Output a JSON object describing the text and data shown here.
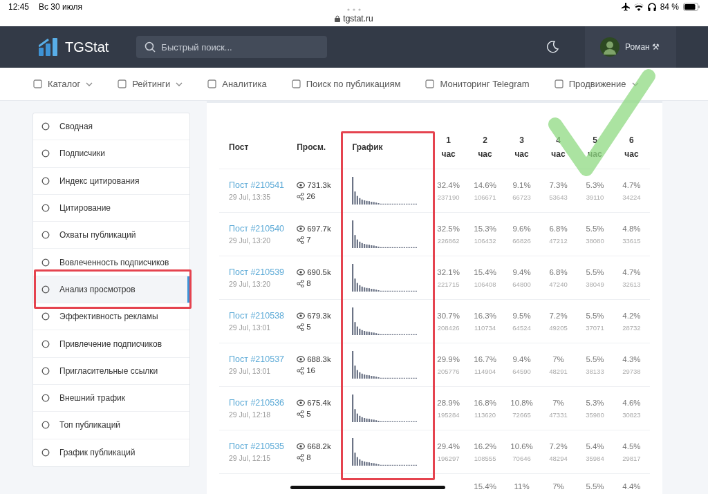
{
  "status_bar": {
    "time": "12:45",
    "date": "Вс 30 июля",
    "address": "tgstat.ru",
    "battery": "84 %"
  },
  "header": {
    "logo": "TGStat",
    "search": {
      "placeholder": "Быстрый поиск..."
    },
    "user": "Роман ⚒"
  },
  "nav": [
    {
      "label": "Каталог",
      "dropdown": true
    },
    {
      "label": "Рейтинги",
      "dropdown": true
    },
    {
      "label": "Аналитика",
      "dropdown": false
    },
    {
      "label": "Поиск по публикациям",
      "dropdown": false
    },
    {
      "label": "Мониторинг Telegram",
      "dropdown": false
    },
    {
      "label": "Продвижение",
      "dropdown": true
    }
  ],
  "sidebar": {
    "items": [
      {
        "label": "Сводная",
        "selected": false
      },
      {
        "label": "Подписчики",
        "selected": false
      },
      {
        "label": "Индекс цитирования",
        "selected": false
      },
      {
        "label": "Цитирование",
        "selected": false
      },
      {
        "label": "Охваты публикаций",
        "selected": false
      },
      {
        "label": "Вовлеченность подписчиков",
        "selected": false
      },
      {
        "label": "Анализ просмотров",
        "selected": true
      },
      {
        "label": "Эффективность рекламы",
        "selected": false
      },
      {
        "label": "Привлечение подписчиков",
        "selected": false
      },
      {
        "label": "Пригласительные ссылки",
        "selected": false
      },
      {
        "label": "Внешний трафик",
        "selected": false
      },
      {
        "label": "Топ публикаций",
        "selected": false
      },
      {
        "label": "График публикаций",
        "selected": false
      }
    ]
  },
  "table": {
    "columns": [
      "Пост",
      "Просм.",
      "График"
    ],
    "hour_columns": [
      {
        "number": "1",
        "unit": "час"
      },
      {
        "number": "2",
        "unit": "час"
      },
      {
        "number": "3",
        "unit": "час"
      },
      {
        "number": "4",
        "unit": "час"
      },
      {
        "number": "5",
        "unit": "час"
      },
      {
        "number": "6",
        "unit": "час"
      }
    ],
    "rows": [
      {
        "post": "Пост #210541",
        "date": "29 Jul, 13:35",
        "views": "731.3k",
        "shares": "26",
        "hours": [
          [
            "32.4%",
            "237190"
          ],
          [
            "14.6%",
            "106671"
          ],
          [
            "9.1%",
            "66723"
          ],
          [
            "7.3%",
            "53643"
          ],
          [
            "5.3%",
            "39110"
          ],
          [
            "4.7%",
            "34224"
          ]
        ]
      },
      {
        "post": "Пост #210540",
        "date": "29 Jul, 13:20",
        "views": "697.7k",
        "shares": "7",
        "hours": [
          [
            "32.5%",
            "226862"
          ],
          [
            "15.3%",
            "106432"
          ],
          [
            "9.6%",
            "66826"
          ],
          [
            "6.8%",
            "47212"
          ],
          [
            "5.5%",
            "38080"
          ],
          [
            "4.8%",
            "33615"
          ]
        ]
      },
      {
        "post": "Пост #210539",
        "date": "29 Jul, 13:20",
        "views": "690.5k",
        "shares": "8",
        "hours": [
          [
            "32.1%",
            "221715"
          ],
          [
            "15.4%",
            "106408"
          ],
          [
            "9.4%",
            "64800"
          ],
          [
            "6.8%",
            "47240"
          ],
          [
            "5.5%",
            "38049"
          ],
          [
            "4.7%",
            "32613"
          ]
        ]
      },
      {
        "post": "Пост #210538",
        "date": "29 Jul, 13:01",
        "views": "679.3k",
        "shares": "5",
        "hours": [
          [
            "30.7%",
            "208426"
          ],
          [
            "16.3%",
            "110734"
          ],
          [
            "9.5%",
            "64524"
          ],
          [
            "7.2%",
            "49205"
          ],
          [
            "5.5%",
            "37071"
          ],
          [
            "4.2%",
            "28732"
          ]
        ]
      },
      {
        "post": "Пост #210537",
        "date": "29 Jul, 13:01",
        "views": "688.3k",
        "shares": "16",
        "hours": [
          [
            "29.9%",
            "205776"
          ],
          [
            "16.7%",
            "114904"
          ],
          [
            "9.4%",
            "64590"
          ],
          [
            "7%",
            "48291"
          ],
          [
            "5.5%",
            "38133"
          ],
          [
            "4.3%",
            "29738"
          ]
        ]
      },
      {
        "post": "Пост #210536",
        "date": "29 Jul, 12:18",
        "views": "675.4k",
        "shares": "5",
        "hours": [
          [
            "28.9%",
            "195284"
          ],
          [
            "16.8%",
            "113620"
          ],
          [
            "10.8%",
            "72665"
          ],
          [
            "7%",
            "47331"
          ],
          [
            "5.3%",
            "35980"
          ],
          [
            "4.6%",
            "30823"
          ]
        ]
      },
      {
        "post": "Пост #210535",
        "date": "29 Jul, 12:15",
        "views": "668.2k",
        "shares": "8",
        "hours": [
          [
            "29.4%",
            "196297"
          ],
          [
            "16.2%",
            "108555"
          ],
          [
            "10.6%",
            "70646"
          ],
          [
            "7.2%",
            "48294"
          ],
          [
            "5.4%",
            "35984"
          ],
          [
            "4.5%",
            "29817"
          ]
        ]
      }
    ],
    "partial_row": {
      "hours": [
        "15.4%",
        "11%",
        "7%",
        "5.5%",
        "4.4%"
      ]
    }
  }
}
